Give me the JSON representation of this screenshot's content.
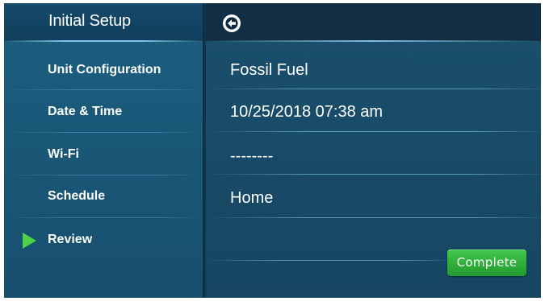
{
  "sidebar": {
    "title": "Initial Setup",
    "items": [
      {
        "label": "Unit Configuration",
        "active": false
      },
      {
        "label": "Date & Time",
        "active": false
      },
      {
        "label": "Wi-Fi",
        "active": false
      },
      {
        "label": "Schedule",
        "active": false
      },
      {
        "label": "Review",
        "active": true
      }
    ]
  },
  "header": {
    "back_icon": "back-arrow-circle-icon"
  },
  "main": {
    "values": [
      "Fossil Fuel",
      "10/25/2018 07:38 am",
      "--------",
      "Home"
    ],
    "complete_label": "Complete"
  },
  "colors": {
    "active_indicator": "#4fd14a",
    "complete_button": "#2fae3a",
    "background": "#184b67"
  }
}
